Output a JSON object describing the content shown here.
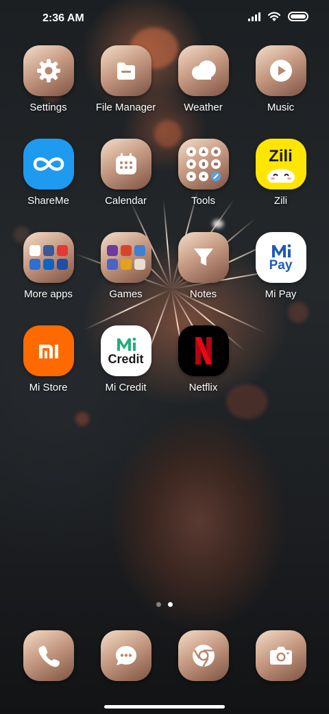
{
  "status_bar": {
    "time": "2:36 AM",
    "battery_level": 1.0
  },
  "home_apps": [
    {
      "label": "Settings",
      "icon": "gear-icon"
    },
    {
      "label": "File Manager",
      "icon": "folder-icon"
    },
    {
      "label": "Weather",
      "icon": "cloud-icon"
    },
    {
      "label": "Music",
      "icon": "play-icon"
    },
    {
      "label": "ShareMe",
      "icon": "infinity-icon"
    },
    {
      "label": "Calendar",
      "icon": "calendar-icon"
    },
    {
      "label": "Tools",
      "icon": "tools-folder-icon"
    },
    {
      "label": "Zili",
      "icon": "zili-logo",
      "logo_text": "Zili"
    },
    {
      "label": "More apps",
      "icon": "apps-folder-icon"
    },
    {
      "label": "Games",
      "icon": "games-folder-icon"
    },
    {
      "label": "Notes",
      "icon": "notes-icon"
    },
    {
      "label": "Mi Pay",
      "icon": "mi-pay-logo",
      "logo_text": "Pay"
    },
    {
      "label": "Mi Store",
      "icon": "mi-logo"
    },
    {
      "label": "Mi Credit",
      "icon": "mi-credit-logo",
      "logo_text": "Credit"
    },
    {
      "label": "Netflix",
      "icon": "netflix-logo"
    }
  ],
  "page_indicator": {
    "pages": 2,
    "current": 2
  },
  "dock": [
    {
      "name": "phone",
      "icon": "phone-icon"
    },
    {
      "name": "messages",
      "icon": "message-icon"
    },
    {
      "name": "browser",
      "icon": "chrome-icon"
    },
    {
      "name": "camera",
      "icon": "camera-icon"
    }
  ],
  "colors": {
    "tile_gradient_light": "#f3dcc9",
    "tile_gradient_dark": "#7e5343",
    "shareme_blue": "#1e9bf0",
    "zili_yellow": "#ffe600",
    "mi_orange": "#ff6a00",
    "mi_credit_green": "#1fb07a",
    "mi_pay_blue": "#1e5bb8",
    "netflix_red": "#e50914"
  }
}
